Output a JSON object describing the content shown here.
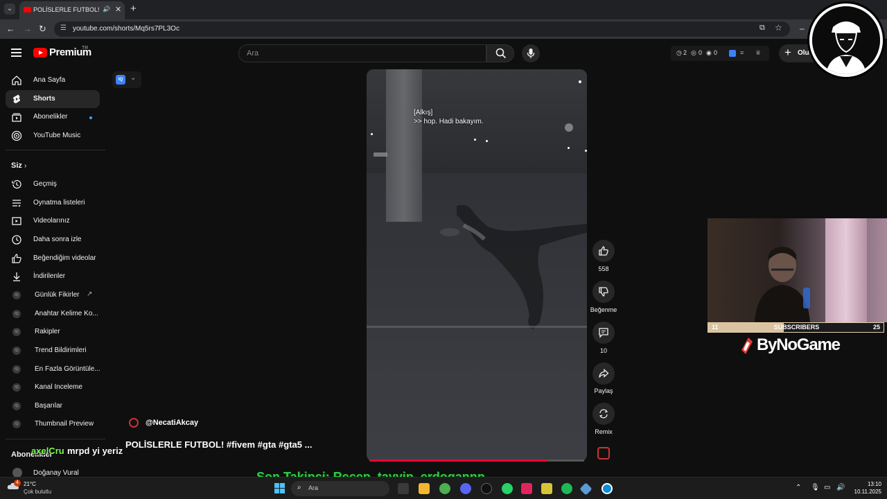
{
  "browser": {
    "tab_title": "POLİSLERLE FUTBOL! #fiven",
    "url": "youtube.com/shorts/Mq5rs7PL3Oc"
  },
  "youtube": {
    "logo_text": "Premium",
    "logo_region": "TR",
    "search_placeholder": "Ara",
    "ext_stats": {
      "a": "2",
      "b": "0",
      "c": "0"
    },
    "create_label": "Oluş"
  },
  "sidebar": {
    "main": [
      {
        "label": "Ana Sayfa",
        "icon": "home-icon"
      },
      {
        "label": "Shorts",
        "icon": "shorts-icon"
      },
      {
        "label": "Abonelikler",
        "icon": "subscriptions-icon"
      },
      {
        "label": "YouTube Music",
        "icon": "youtube-music-icon"
      }
    ],
    "you_section_title": "Siz",
    "you": [
      {
        "label": "Geçmiş",
        "icon": "history-icon"
      },
      {
        "label": "Oynatma listeleri",
        "icon": "playlist-icon"
      },
      {
        "label": "Videolarınız",
        "icon": "your-videos-icon"
      },
      {
        "label": "Daha sonra izle",
        "icon": "watch-later-icon"
      },
      {
        "label": "Beğendiğim videolar",
        "icon": "liked-icon"
      },
      {
        "label": "İndirilenler",
        "icon": "download-icon"
      }
    ],
    "extension_items": [
      "Günlük Fikirler",
      "Anahtar Kelime Ko...",
      "Rakipler",
      "Trend Bildirimleri",
      "En Fazla Görüntüle...",
      "Kanal Inceleme",
      "Başarılar",
      "Thumbnail Preview"
    ],
    "extension_icon_label": "IQ",
    "subs_title": "Abonelikler",
    "subs": [
      {
        "label": "Doğanay Vural"
      }
    ]
  },
  "iq_button": {
    "label": "IQ"
  },
  "video": {
    "caption_line1": "[Alkış]",
    "caption_line2": ">> hop. Hadi bakayım.",
    "channel": "@NecatiAkcay",
    "title": "POLİSLERLE FUTBOL! #fivem #gta #gta5 ...",
    "progress": 0.83
  },
  "actions": {
    "like_count": "558",
    "dislike_label": "Beğenme",
    "comment_count": "10",
    "share_label": "Paylaş",
    "remix_label": "Remix"
  },
  "overlay": {
    "sub_goal_left": "11",
    "sub_goal_label": "SUBSCRIBERS",
    "sub_goal_right": "25",
    "sub_progress": 0.43,
    "brand": "ByNoGame",
    "chat_user": "axelCru",
    "chat_message": "mrpd yi yeriz",
    "last_follower": "Son Takipçi: Recep_tayyip_erdogannn"
  },
  "taskbar": {
    "weather_badge": "4",
    "temperature": "21°C",
    "weather_desc": "Çok bulutlu",
    "search_label": "Ara",
    "time": "13:10",
    "date": "10.11.2025"
  },
  "colors": {
    "youtube_red": "#ff0000",
    "progress_red": "#ff0033",
    "follower_green": "#2ecc40",
    "chat_user_green": "#7cfc50"
  }
}
